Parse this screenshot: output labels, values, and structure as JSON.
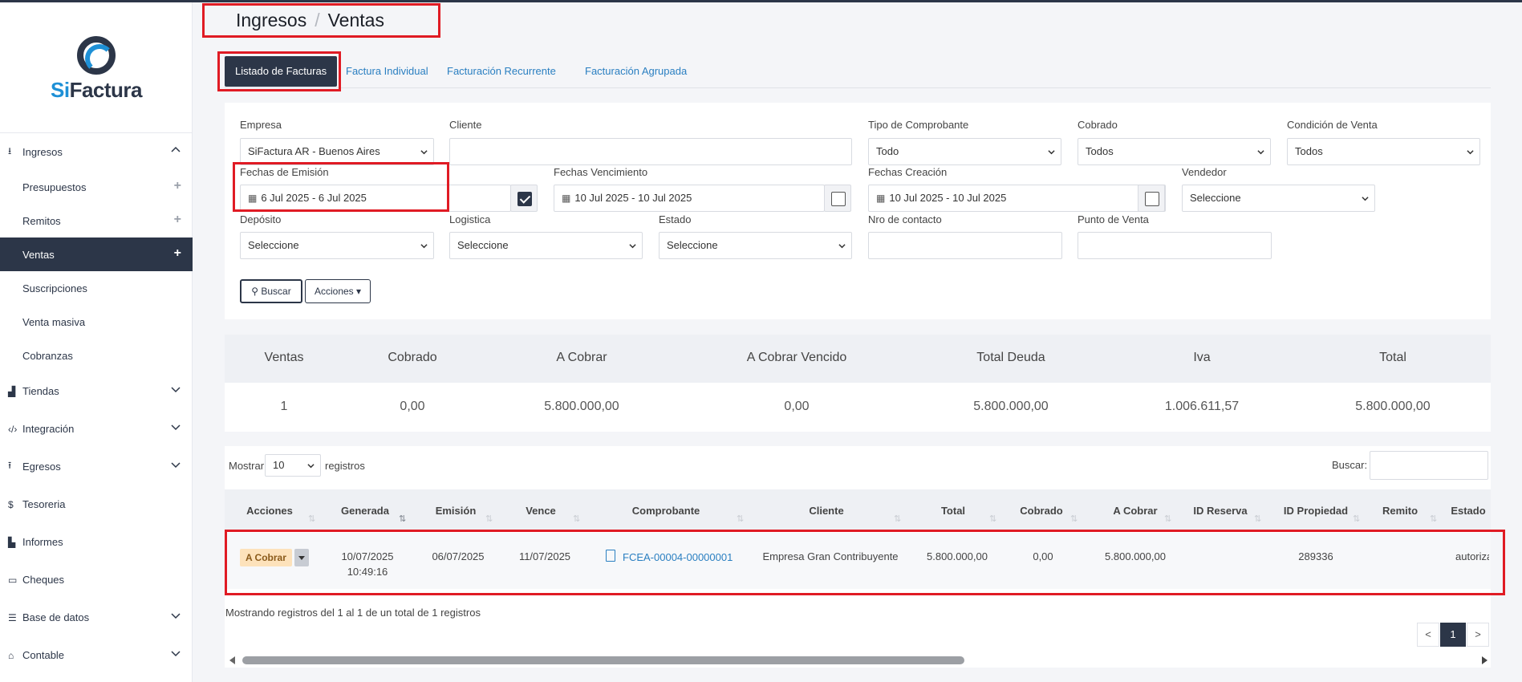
{
  "brand": {
    "prefix": "Si",
    "suffix": "Factura"
  },
  "sidebar": {
    "items": [
      {
        "label": "Ingresos",
        "icon": "download-icon"
      },
      {
        "label": "Presupuestos"
      },
      {
        "label": "Remitos"
      },
      {
        "label": "Ventas"
      },
      {
        "label": "Suscripciones"
      },
      {
        "label": "Venta masiva"
      },
      {
        "label": "Cobranzas"
      },
      {
        "label": "Tiendas",
        "icon": "shopping-bag-icon"
      },
      {
        "label": "Integración",
        "icon": "code-icon"
      },
      {
        "label": "Egresos",
        "icon": "upload-icon"
      },
      {
        "label": "Tesoreria",
        "icon": "dollar-icon"
      },
      {
        "label": "Informes",
        "icon": "chart-icon"
      },
      {
        "label": "Cheques",
        "icon": "credit-card-icon"
      },
      {
        "label": "Base de datos",
        "icon": "database-icon"
      },
      {
        "label": "Contable",
        "icon": "bank-icon"
      }
    ]
  },
  "breadcrumb": {
    "parent": "Ingresos",
    "separator": "/",
    "current": "Ventas"
  },
  "tabs": [
    "Listado de Facturas",
    "Factura Individual",
    "Facturación Recurrente",
    "Facturación Agrupada"
  ],
  "filters": {
    "empresa": {
      "label": "Empresa",
      "value": "SiFactura AR - Buenos Aires"
    },
    "cliente": {
      "label": "Cliente",
      "value": ""
    },
    "tipo": {
      "label": "Tipo de Comprobante",
      "value": "Todo"
    },
    "cobrado": {
      "label": "Cobrado",
      "value": "Todos"
    },
    "condicion": {
      "label": "Condición de Venta",
      "value": "Todos"
    },
    "emision": {
      "label": "Fechas de Emisión",
      "value": "6 Jul 2025 - 6 Jul 2025",
      "checked": true
    },
    "vencimiento": {
      "label": "Fechas Vencimiento",
      "value": "10 Jul 2025 - 10 Jul 2025",
      "checked": false
    },
    "creacion": {
      "label": "Fechas Creación",
      "value": "10 Jul 2025 - 10 Jul 2025",
      "checked": false
    },
    "vendedor": {
      "label": "Vendedor",
      "value": "Seleccione"
    },
    "deposito": {
      "label": "Depósito",
      "value": "Seleccione"
    },
    "logistica": {
      "label": "Logistica",
      "value": "Seleccione"
    },
    "estado": {
      "label": "Estado",
      "value": "Seleccione"
    },
    "contacto": {
      "label": "Nro de contacto",
      "value": ""
    },
    "punto": {
      "label": "Punto de Venta",
      "value": ""
    }
  },
  "actions": {
    "search": "Buscar",
    "more": "Acciones"
  },
  "summary": {
    "headers": [
      "Ventas",
      "Cobrado",
      "A Cobrar",
      "A Cobrar Vencido",
      "Total Deuda",
      "Iva",
      "Total"
    ],
    "values": [
      "1",
      "0,00",
      "5.800.000,00",
      "0,00",
      "5.800.000,00",
      "1.006.611,57",
      "5.800.000,00"
    ]
  },
  "table": {
    "show_label": "Mostrar",
    "page_size": "10",
    "records_label": "registros",
    "search_label": "Buscar:",
    "columns": [
      "Acciones",
      "Generada",
      "Emisión",
      "Vence",
      "Comprobante",
      "Cliente",
      "Total",
      "Cobrado",
      "A Cobrar",
      "ID Reserva",
      "ID Propiedad",
      "Remito",
      "Estado"
    ],
    "rows": [
      {
        "status": "A Cobrar",
        "generada_date": "10/07/2025",
        "generada_time": "10:49:16",
        "emision": "06/07/2025",
        "vence": "11/07/2025",
        "comprobante": "FCEA-00004-00000001",
        "cliente": "Empresa Gran Contribuyente",
        "total": "5.800.000,00",
        "cobrado": "0,00",
        "a_cobrar": "5.800.000,00",
        "id_reserva": "",
        "id_propiedad": "289336",
        "remito": "",
        "estado": "autorizac"
      }
    ],
    "info": "Mostrando registros del 1 al 1 de un total de 1 registros",
    "pagination": {
      "prev": "<",
      "current": "1",
      "next": ">"
    }
  },
  "colors": {
    "primary": "#2c3648",
    "link": "#2a7fc1",
    "highlight": "#e01b24",
    "badge": "#fde2bb"
  }
}
